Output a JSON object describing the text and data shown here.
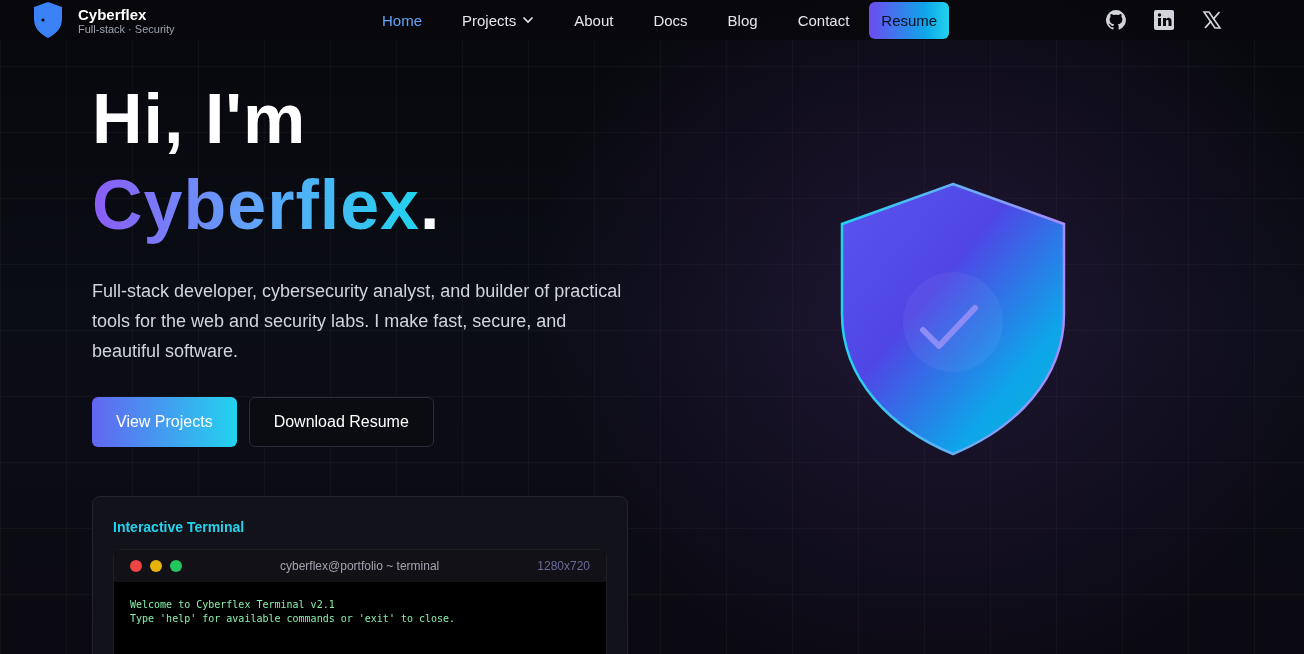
{
  "brand": {
    "name": "Cyberflex",
    "tagline": "Full-stack · Security"
  },
  "nav": [
    {
      "label": "Home",
      "selected": true,
      "kind": "link"
    },
    {
      "label": "Projects",
      "selected": false,
      "kind": "dropdown"
    },
    {
      "label": "About",
      "selected": false,
      "kind": "link"
    },
    {
      "label": "Docs",
      "selected": false,
      "kind": "link"
    },
    {
      "label": "Blog",
      "selected": false,
      "kind": "link"
    },
    {
      "label": "Contact",
      "selected": false,
      "kind": "link"
    },
    {
      "label": "Resume",
      "selected": false,
      "kind": "cta"
    }
  ],
  "social": [
    {
      "kind": "github"
    },
    {
      "kind": "linkedin"
    },
    {
      "kind": "x"
    }
  ],
  "hero": {
    "greeting": "Hi, I'm",
    "name": "Cyberflex",
    "name_end": ".",
    "intro": "Full-stack developer, cybersecurity analyst, and builder of practical tools for the web and security labs. I make fast, secure, and beautiful software.",
    "buttons": [
      {
        "label": "View Projects",
        "kind": "primary"
      },
      {
        "label": "Download Resume",
        "kind": "secondary"
      }
    ]
  },
  "terminal": {
    "heading": "Interactive Terminal",
    "title": "cyberflex@portfolio ~ terminal",
    "size": "1280x720",
    "lines": [
      "Welcome to Cyberflex Terminal v2.1",
      "Type 'help' for available commands or 'exit' to close."
    ]
  }
}
